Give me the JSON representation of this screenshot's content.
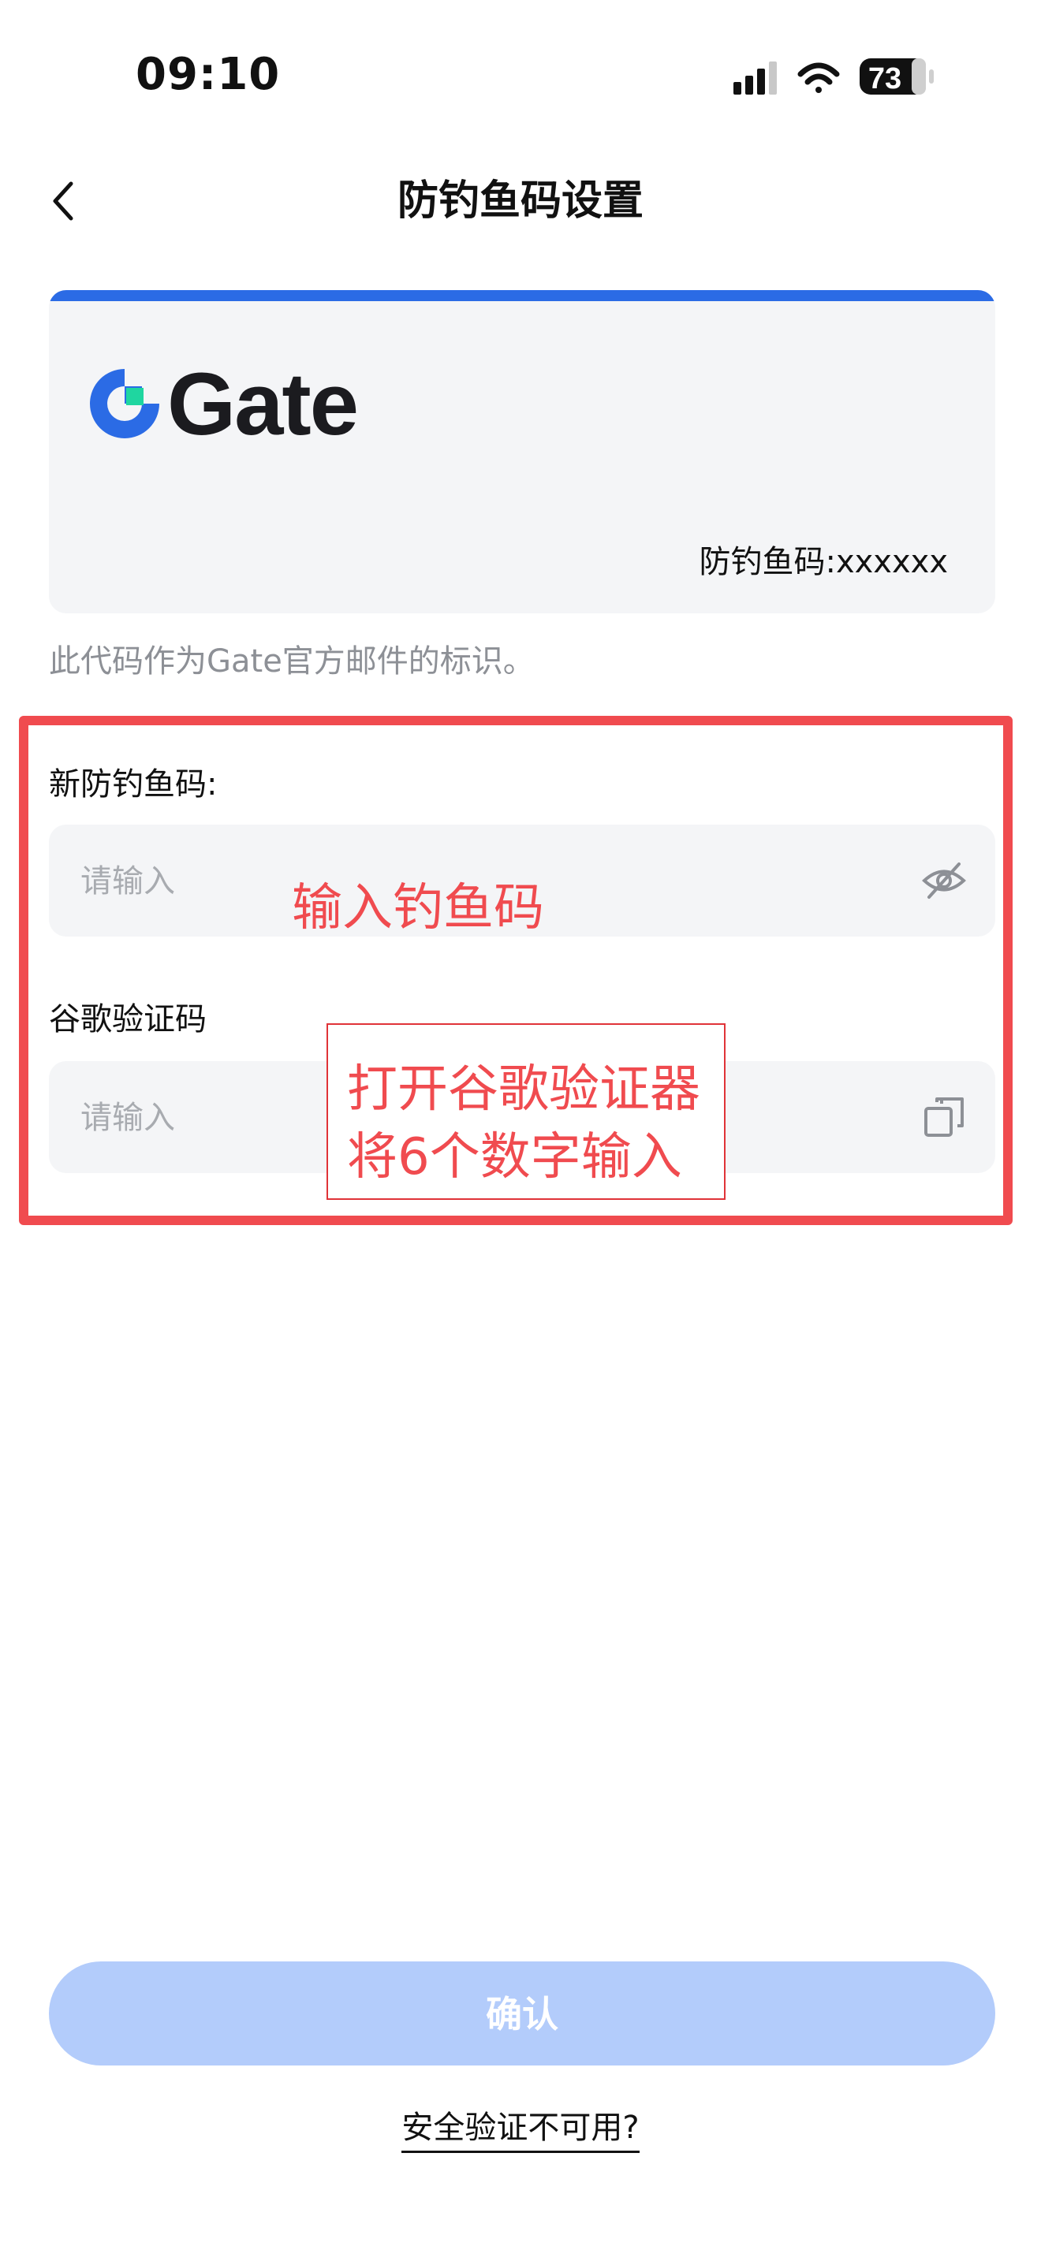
{
  "status_bar": {
    "time": "09:10",
    "battery": "73"
  },
  "nav": {
    "title": "防钓鱼码设置"
  },
  "preview_card": {
    "brand": "Gate",
    "code_label": "防钓鱼码:xxxxxx"
  },
  "hint": "此代码作为Gate官方邮件的标识。",
  "form": {
    "new_code_label": "新防钓鱼码:",
    "new_code_placeholder": "请输入",
    "google_code_label": "谷歌验证码",
    "google_code_placeholder": "请输入"
  },
  "annotations": {
    "enter_code": "输入钓鱼码",
    "google_line1": "打开谷歌验证器",
    "google_line2": "将6个数字输入"
  },
  "actions": {
    "confirm": "确认",
    "unavailable": "安全验证不可用?"
  },
  "colors": {
    "accent": "#2b6be5",
    "confirm_disabled": "#b3ccfb",
    "annotation_red": "#f04b4f"
  }
}
